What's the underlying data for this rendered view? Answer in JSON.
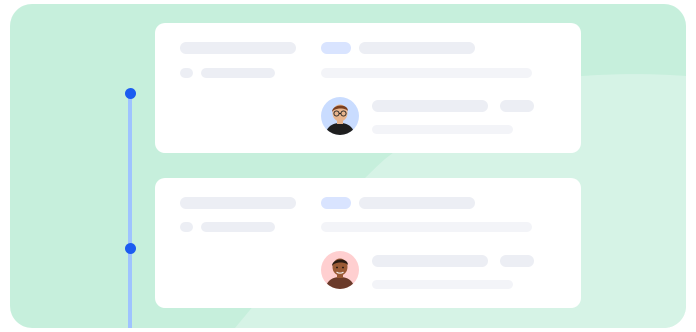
{
  "timeline": {
    "entries": [
      {
        "avatar_icon": "person-avatar-icon",
        "avatar_bg": "#c9dcff",
        "skin": "#e8b58e",
        "hair": "#7a3f1f",
        "shirt": "#1f1f1f",
        "glasses": true
      },
      {
        "avatar_icon": "person-avatar-icon",
        "avatar_bg": "#ffcfd0",
        "skin": "#9a5a36",
        "hair": "#2a1a12",
        "shirt": "#6b3b2a",
        "glasses": false
      }
    ]
  },
  "colors": {
    "background": "#c6efdc",
    "card": "#ffffff",
    "skeleton": "#eceef4",
    "skeleton_tag": "#d9e4ff",
    "timeline_line": "#9fc3ff",
    "timeline_dot": "#1c5cf0"
  }
}
